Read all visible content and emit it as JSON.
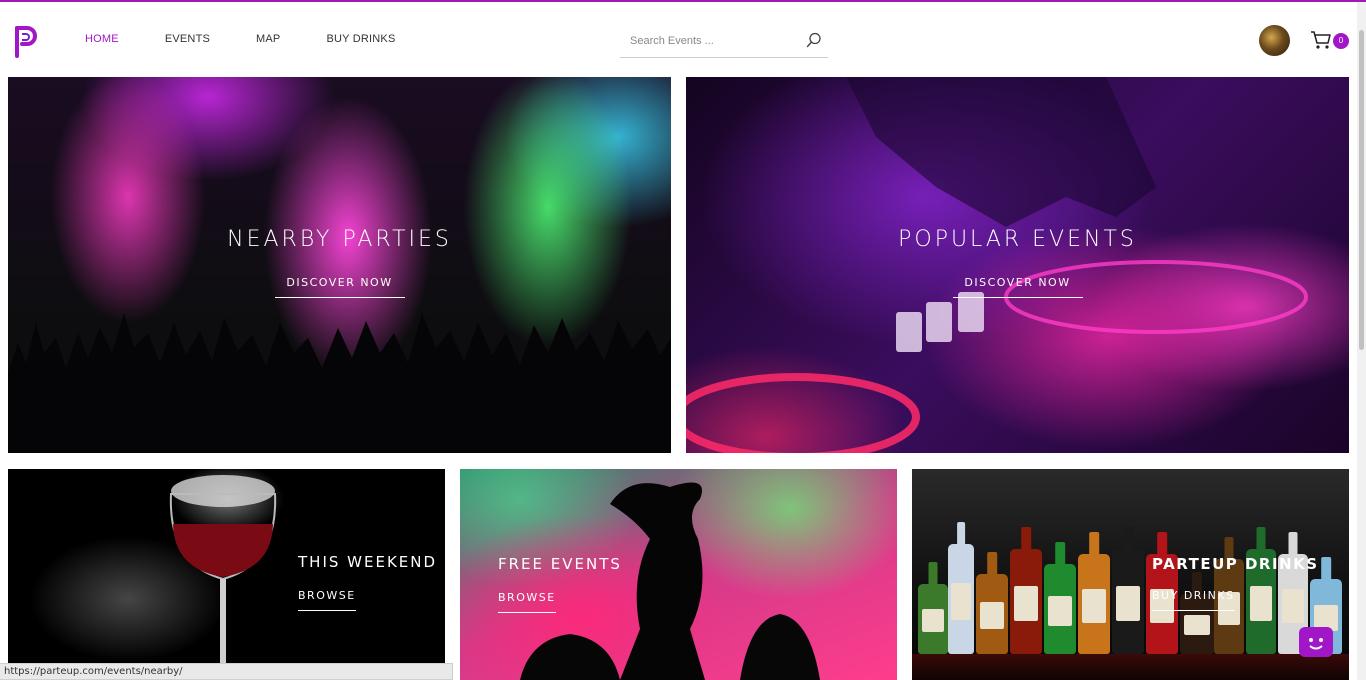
{
  "brand": {
    "logo_icon": "parteup-p-logo-icon",
    "accent": "#a117c8"
  },
  "nav": {
    "items": [
      {
        "label": "HOME",
        "active": true
      },
      {
        "label": "EVENTS",
        "active": false
      },
      {
        "label": "MAP",
        "active": false
      },
      {
        "label": "BUY DRINKS",
        "active": false
      }
    ]
  },
  "search": {
    "placeholder": "Search Events ...",
    "value": "",
    "icon": "search-icon"
  },
  "user": {
    "avatar_icon": "user-avatar"
  },
  "cart": {
    "icon": "cart-icon",
    "count": "0"
  },
  "tiles": {
    "nearby": {
      "title": "NEARBY PARTIES",
      "button": "DISCOVER NOW"
    },
    "popular": {
      "title": "POPULAR EVENTS",
      "button": "DISCOVER NOW"
    },
    "weekend": {
      "title": "THIS WEEKEND",
      "button": "BROWSE"
    },
    "free": {
      "title": "FREE EVENTS",
      "button": "BROWSE"
    },
    "drinks": {
      "title": "PARTEUP DRINKS",
      "button": "BUY DRINKS"
    }
  },
  "status_bar": {
    "url": "https://parteup.com/events/nearby/"
  },
  "chat": {
    "icon": "chat-bot-icon"
  }
}
